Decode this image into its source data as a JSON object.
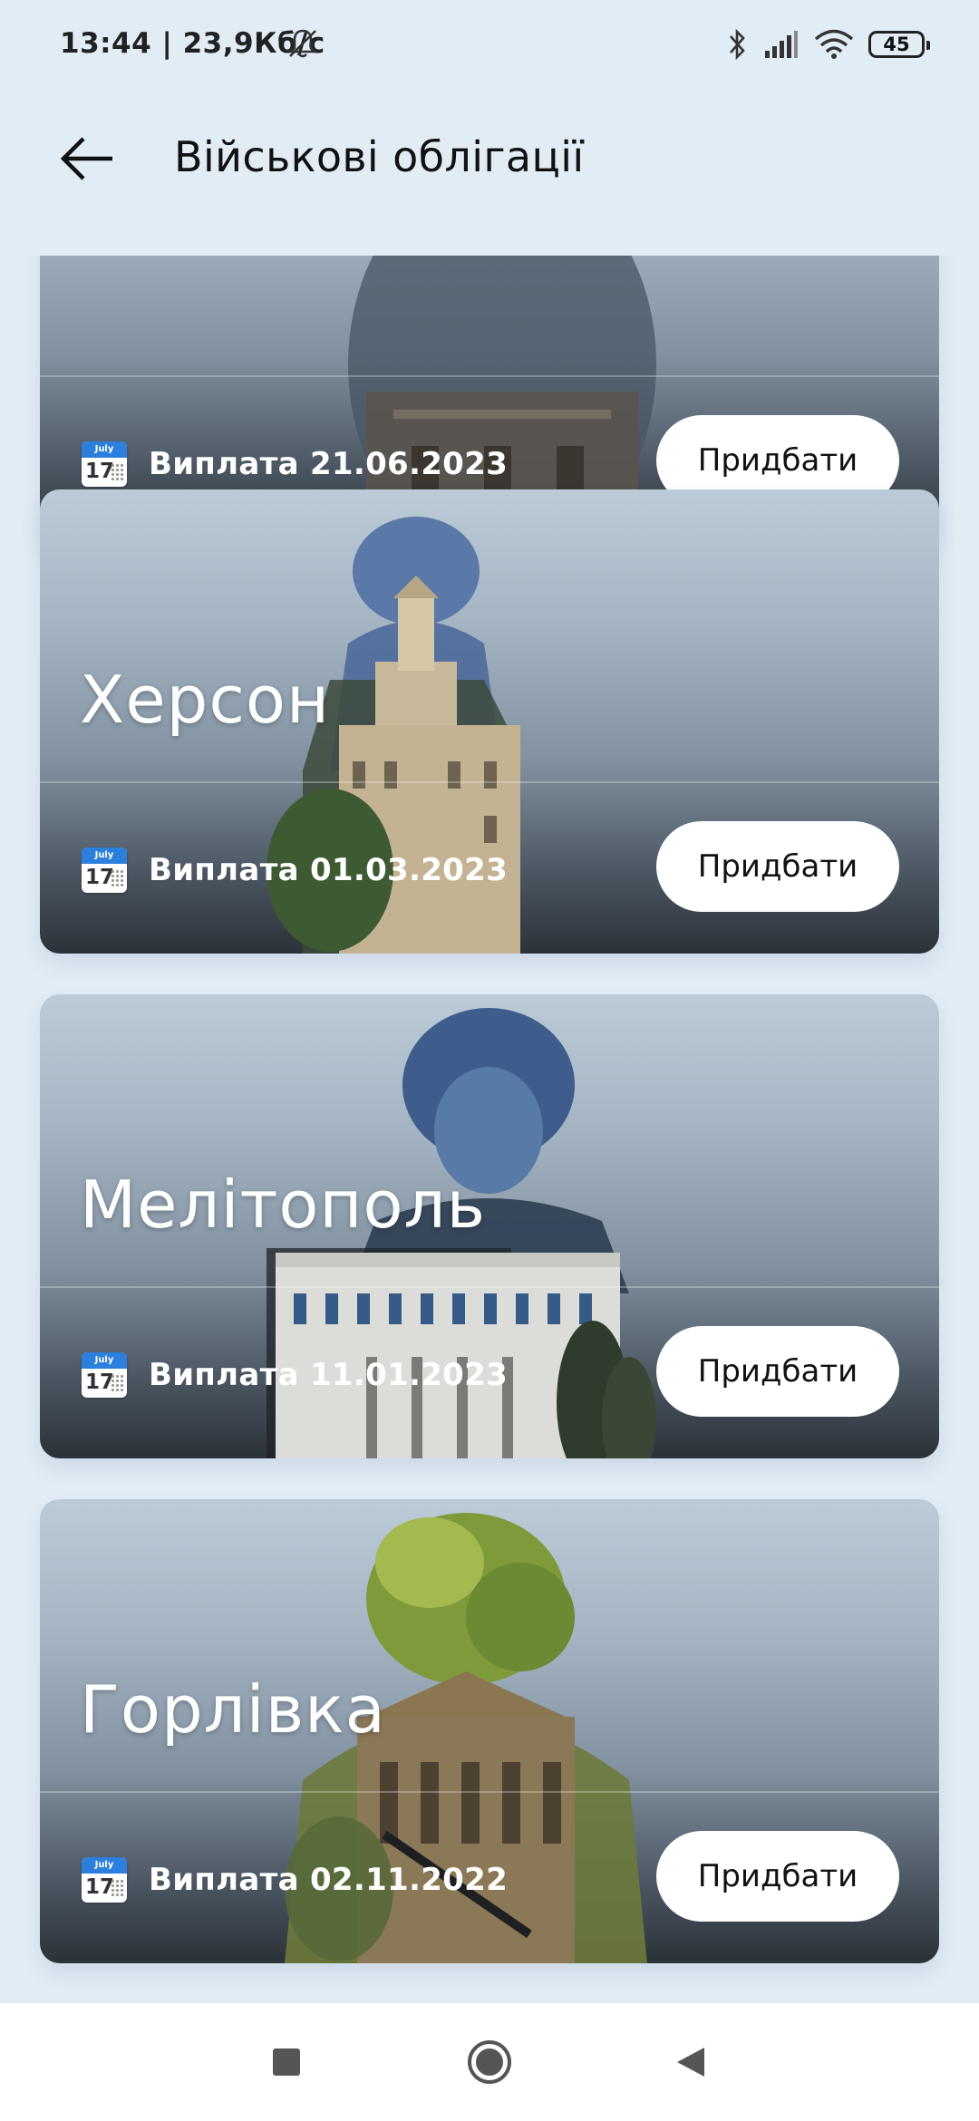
{
  "status_bar": {
    "time_speed": "13:44 | 23,9Кб/с",
    "battery": "45",
    "icons": [
      "bell-off-icon",
      "bluetooth-icon",
      "signal-icon",
      "wifi-icon",
      "battery-icon"
    ]
  },
  "header": {
    "title": "Військові облігації",
    "back_icon": "arrow-left-icon"
  },
  "bonds": [
    {
      "city": "",
      "payout": "Виплата 21.06.2023",
      "buy_label": "Придбати",
      "calendar": {
        "month": "July",
        "day": "17"
      }
    },
    {
      "city": "Херсон",
      "payout": "Виплата 01.03.2023",
      "buy_label": "Придбати",
      "calendar": {
        "month": "July",
        "day": "17"
      }
    },
    {
      "city": "Мелітополь",
      "payout": "Виплата 11.01.2023",
      "buy_label": "Придбати",
      "calendar": {
        "month": "July",
        "day": "17"
      }
    },
    {
      "city": "Горлівка",
      "payout": "Виплата 02.11.2022",
      "buy_label": "Придбати",
      "calendar": {
        "month": "July",
        "day": "17"
      }
    }
  ],
  "nav_bar": {
    "icons": [
      "recent-apps-icon",
      "home-icon",
      "back-triangle-icon"
    ]
  },
  "colors": {
    "background": "#e2ecf5",
    "button": "#ffffff",
    "calendar_blue": "#2c7fdc"
  }
}
